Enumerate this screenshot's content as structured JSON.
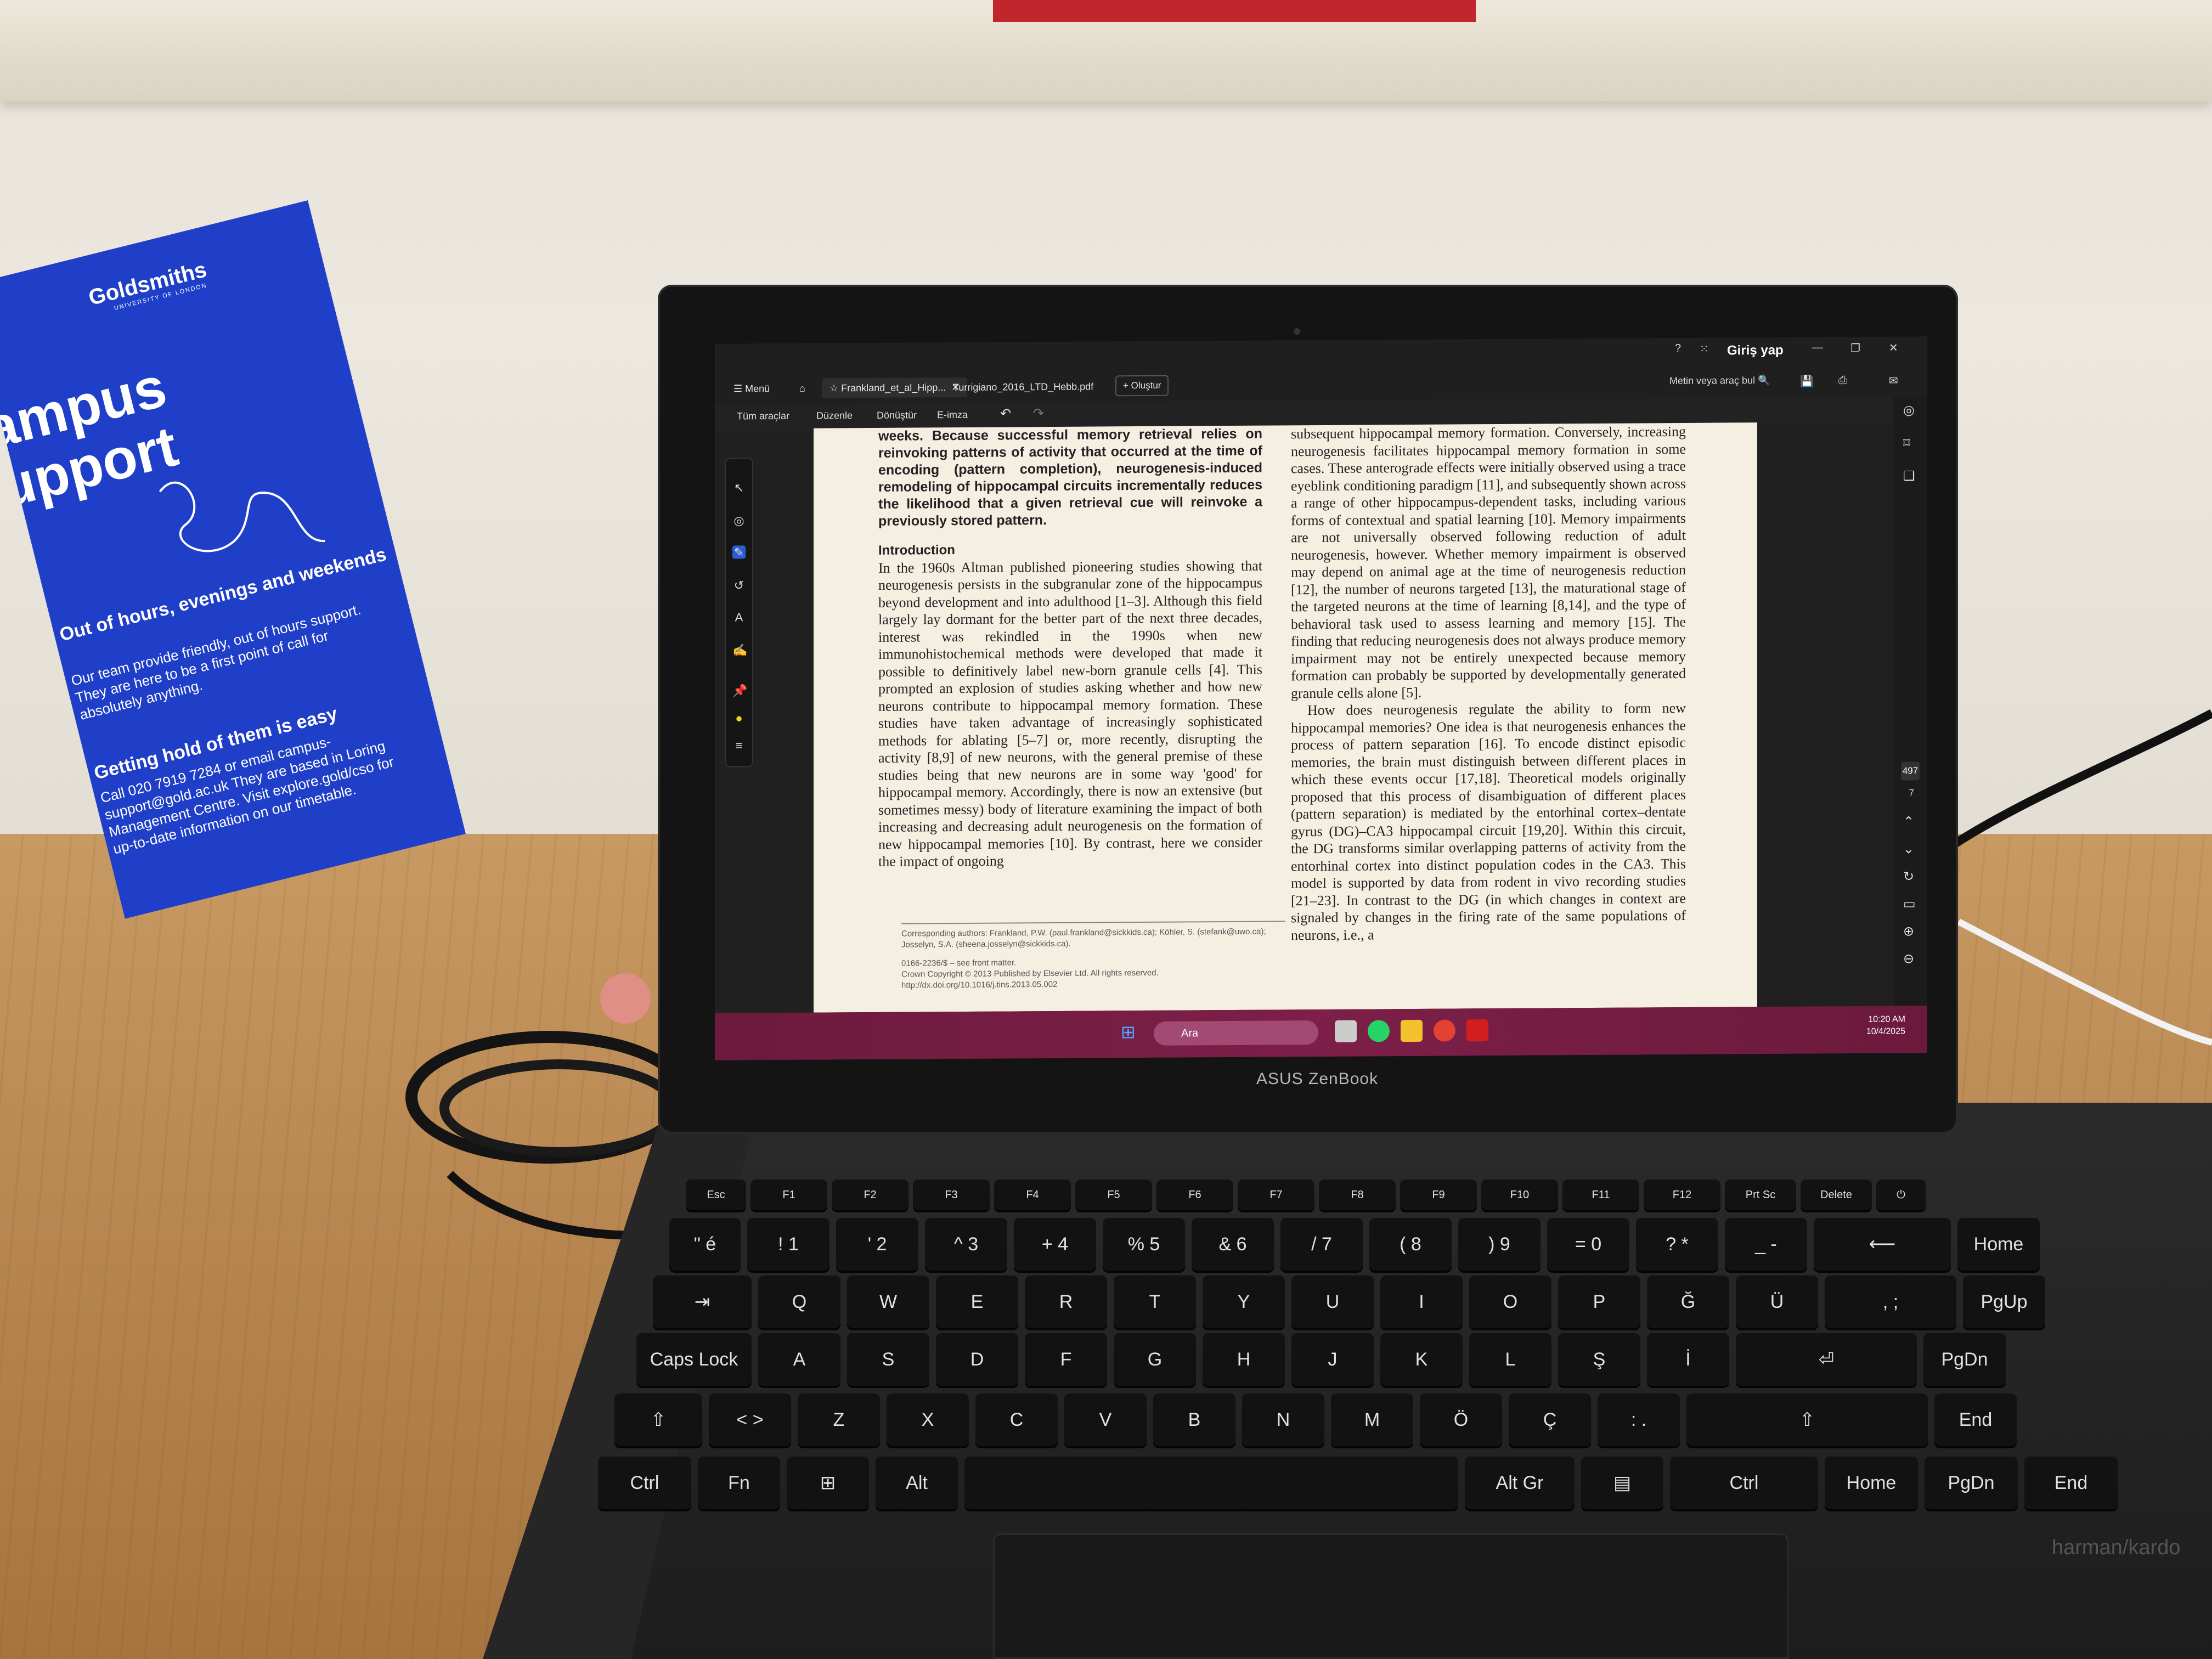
{
  "scene": {
    "brochure": {
      "logo": "Goldsmiths",
      "logo_sub": "UNIVERSITY OF LONDON",
      "title_line1": "ampus",
      "title_line2": "upport",
      "section1_heading": "Out of hours, evenings and weekends",
      "section1_text": "Our team provide friendly, out of hours support. They are here to be a first point of call for absolutely anything.",
      "section2_heading": "Getting hold of them is easy",
      "section2_text": "Call 020 7919 7284 or email campus-support@gold.ac.uk They are based in Loring Management Centre. Visit explore.gold/cso for up-to-date information on our timetable."
    },
    "laptop_brand": "ASUS ZenBook",
    "speaker_brand": "harman/kardo"
  },
  "app": {
    "menu_label": "Menü",
    "tabs": [
      {
        "label": "Frankland_et_al_Hipp...",
        "active": true
      },
      {
        "label": "Turrigiano_2016_LTD_Hebb.pdf",
        "active": false
      }
    ],
    "create_label": "+ Oluştur",
    "signin_label": "Giriş yap",
    "search_tools_label": "Metin veya araç bul",
    "toolbar": [
      "Tüm araçlar",
      "Düzenle",
      "Dönüştür",
      "E-imza"
    ],
    "page_number": "497",
    "page_count": "7"
  },
  "document": {
    "abstract": "weeks. Because successful memory retrieval relies on reinvoking patterns of activity that occurred at the time of encoding (pattern completion), neurogenesis-induced remodeling of hippocampal circuits incrementally reduces the likelihood that a given retrieval cue will reinvoke a previously stored pattern.",
    "intro_heading": "Introduction",
    "intro_text": "In the 1960s Altman published pioneering studies showing that neurogenesis persists in the subgranular zone of the hippocampus beyond development and into adulthood [1–3]. Although this field largely lay dormant for the better part of the next three decades, interest was rekindled in the 1990s when new immunohistochemical methods were developed that made it possible to definitively label new-born granule cells [4]. This prompted an explosion of studies asking whether and how new neurons contribute to hippocampal memory formation. These studies have taken advantage of increasingly sophisticated methods for ablating [5–7] or, more recently, disrupting the activity [8,9] of new neurons, with the general premise of these studies being that new neurons are in some way 'good' for hippocampal memory. Accordingly, there is now an extensive (but sometimes messy) body of literature examining the impact of both increasing and decreasing adult neurogenesis on the formation of new hippocampal memories [10]. By contrast, here we consider the impact of ongoing",
    "right_text_1": "subsequent hippocampal memory formation. Conversely, increasing neurogenesis facilitates hippocampal memory formation in some cases. These anterograde effects were initially observed using a trace eyeblink conditioning paradigm [11], and subsequently shown across a range of other hippocampus-dependent tasks, including various forms of contextual and spatial learning [10]. Memory impairments are not universally observed following reduction of adult neurogenesis, however. Whether memory impairment is observed may depend on animal age at the time of neurogenesis reduction [12], the number of neurons targeted [13], the maturational stage of the targeted neurons at the time of learning [8,14], and the type of behavioral task used to assess learning and memory [15]. The finding that reducing neurogenesis does not always produce memory impairment may not be entirely unexpected because memory formation can probably be supported by developmentally generated granule cells alone [5].",
    "right_text_2": "How does neurogenesis regulate the ability to form new hippocampal memories? One idea is that neurogenesis enhances the process of pattern separation [16]. To encode distinct episodic memories, the brain must distinguish between different places in which these events occur [17,18]. Theoretical models originally proposed that this process of disambiguation of different places (pattern separation) is mediated by the entorhinal cortex–dentate gyrus (DG)–CA3 hippocampal circuit [19,20]. Within this circuit, the DG transforms similar overlapping patterns of activity from the entorhinal cortex into distinct population codes in the CA3. This model is supported by data from rodent in vivo recording studies [21–23]. In contrast to the DG (in which changes in context are signaled by changes in the firing rate of the same populations of neurons, i.e., a",
    "footnote_1": "Corresponding authors: Frankland, P.W. (paul.frankland@sickkids.ca); Köhler, S. (stefank@uwo.ca); Josselyn, S.A. (sheena.josselyn@sickkids.ca).",
    "footnote_2": "0166-2236/$ – see front matter.",
    "footnote_3": "Crown Copyright © 2013 Published by Elsevier Ltd. All rights reserved. http://dx.doi.org/10.1016/j.tins.2013.05.002"
  },
  "taskbar": {
    "search_label": "Ara",
    "time": "10:20 AM",
    "date": "10/4/2025"
  },
  "keyboard": {
    "fn_row": [
      "Esc",
      "F1",
      "F2",
      "F3",
      "F4",
      "F5",
      "F6",
      "F7",
      "F8",
      "F9",
      "F10",
      "F11",
      "F12",
      "Prt Sc",
      "Delete",
      "⏻"
    ],
    "num_row": [
      "\"  é",
      "! 1",
      "' 2",
      "^ 3",
      "+ 4",
      "% 5",
      "& 6",
      "/ 7",
      "( 8",
      ") 9",
      "= 0",
      "? *",
      "_ -",
      "⟵",
      "Home"
    ],
    "q_row": [
      "⇥",
      "Q",
      "W",
      "E",
      "R",
      "T",
      "Y",
      "U",
      "I",
      "O",
      "P",
      "Ğ",
      "Ü",
      ", ;",
      "PgUp"
    ],
    "a_row": [
      "Caps Lock",
      "A",
      "S",
      "D",
      "F",
      "G",
      "H",
      "J",
      "K",
      "L",
      "Ş",
      "İ",
      "⏎",
      "PgDn"
    ],
    "z_row": [
      "⇧",
      "< >",
      "Z",
      "X",
      "C",
      "V",
      "B",
      "N",
      "M",
      "Ö",
      "Ç",
      ": .",
      "⇧",
      "End"
    ],
    "bottom_row": [
      "Ctrl",
      "Fn",
      "⊞",
      "Alt",
      "",
      "Alt Gr",
      "▤",
      "Ctrl",
      "Home",
      "PgDn",
      "End"
    ]
  }
}
